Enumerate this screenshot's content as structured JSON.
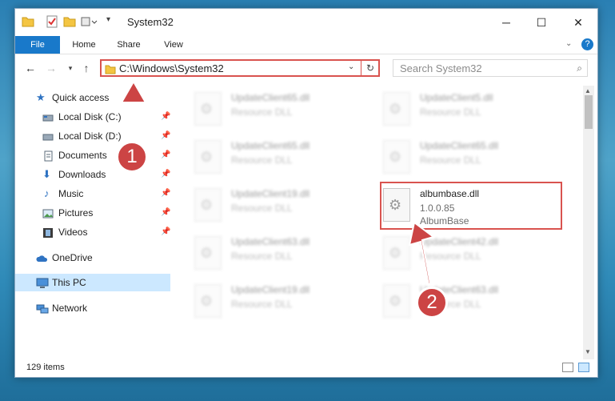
{
  "window": {
    "title": "System32",
    "controls": {
      "minimize": "─",
      "maximize": "☐",
      "close": "✕"
    }
  },
  "ribbon": {
    "tabs": [
      {
        "label": "File"
      },
      {
        "label": "Home"
      },
      {
        "label": "Share"
      },
      {
        "label": "View"
      }
    ],
    "help": "?"
  },
  "address": {
    "path": "C:\\Windows\\System32",
    "search_placeholder": "Search System32"
  },
  "nav": {
    "items": [
      {
        "label": "Quick access"
      },
      {
        "label": "Local Disk (C:)"
      },
      {
        "label": "Local Disk (D:)"
      },
      {
        "label": "Documents"
      },
      {
        "label": "Downloads"
      },
      {
        "label": "Music"
      },
      {
        "label": "Pictures"
      },
      {
        "label": "Videos"
      },
      {
        "label": "OneDrive"
      },
      {
        "label": "This PC"
      },
      {
        "label": "Network"
      }
    ]
  },
  "files": [
    {
      "name": "UpdateClient65.dll",
      "type": "Resource DLL"
    },
    {
      "name": "UpdateClient5.dll",
      "type": "Resource DLL"
    },
    {
      "name": "UpdateClient65.dll",
      "type": "Resource DLL"
    },
    {
      "name": "UpdateClient65.dll",
      "type": "Resource DLL"
    },
    {
      "name": "UpdateClient19.dll",
      "type": "Resource DLL"
    },
    {
      "name": "UpdateClient63.dll",
      "type": "Resource DLL"
    },
    {
      "name": "UpdateClient42.dll",
      "type": "Resource DLL"
    },
    {
      "name": "UpdateClient19.dll",
      "type": "Resource DLL"
    },
    {
      "name": "UpdateClient63.dll",
      "type": "Resource DLL"
    }
  ],
  "highlighted_file": {
    "name": "albumbase.dll",
    "version": "1.0.0.85",
    "description": "AlbumBase"
  },
  "status": {
    "item_count": "129 items"
  },
  "annotations": {
    "step1": "1",
    "step2": "2"
  },
  "colors": {
    "accent": "#1979ca",
    "highlight": "#d9534f",
    "badge": "#cc4444",
    "selection": "#cce8ff"
  }
}
